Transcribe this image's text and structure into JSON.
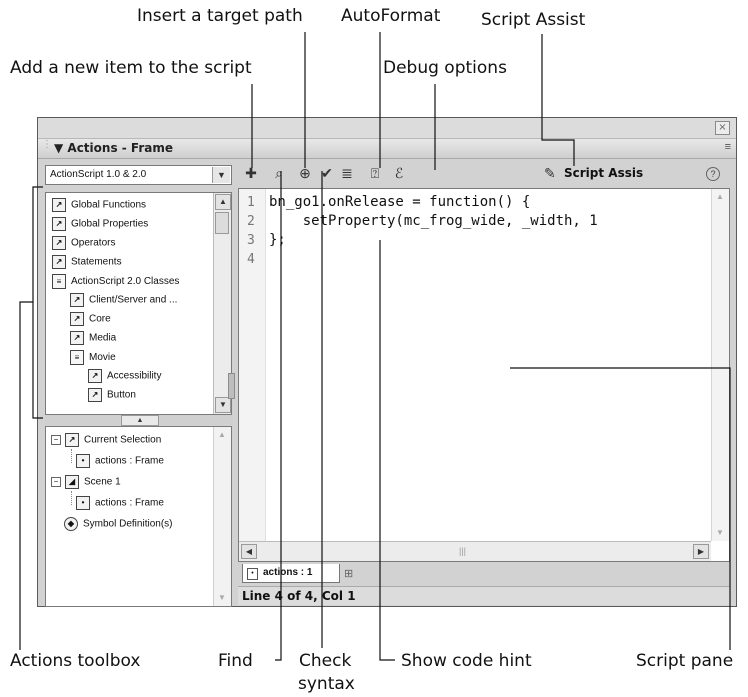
{
  "callouts": {
    "insert_target_path": "Insert a target path",
    "autoformat": "AutoFormat",
    "script_assist": "Script Assist",
    "add_item": "Add a new item to the script",
    "debug_options": "Debug options",
    "actions_toolbox": "Actions toolbox",
    "find": "Find",
    "check_syntax_1": "Check",
    "check_syntax_2": "syntax",
    "show_code_hint": "Show code hint",
    "script_pane": "Script pane"
  },
  "panel": {
    "title": "Actions - Frame",
    "close_glyph": "×",
    "menu_glyph": "≡"
  },
  "language_select": {
    "value": "ActionScript 1.0 & 2.0"
  },
  "toolbox": {
    "items": [
      {
        "label": "Global Functions",
        "kind": "book"
      },
      {
        "label": "Global Properties",
        "kind": "book"
      },
      {
        "label": "Operators",
        "kind": "book"
      },
      {
        "label": "Statements",
        "kind": "book"
      },
      {
        "label": "ActionScript 2.0 Classes",
        "kind": "open-book"
      },
      {
        "label": "Client/Server and ...",
        "kind": "book"
      },
      {
        "label": "Core",
        "kind": "book"
      },
      {
        "label": "Media",
        "kind": "book"
      },
      {
        "label": "Movie",
        "kind": "open-book"
      },
      {
        "label": "Accessibility",
        "kind": "book"
      },
      {
        "label": "Button",
        "kind": "book"
      }
    ]
  },
  "script_nav": {
    "items": [
      {
        "label": "Current Selection",
        "expander": "⊟"
      },
      {
        "label": "actions : Frame"
      },
      {
        "label": "Scene 1",
        "expander": "⊟"
      },
      {
        "label": "actions : Frame"
      },
      {
        "label": "Symbol Definition(s)"
      }
    ]
  },
  "toolbar": {
    "script_assist_label": "Script Assis",
    "help_glyph": "?"
  },
  "code": {
    "line_numbers": [
      "1",
      "2",
      "3",
      "4"
    ],
    "lines": [
      "bn_go1.onRelease = function() {",
      "    setProperty(mc_frog_wide, _width, 1",
      "};",
      ""
    ]
  },
  "tab": {
    "label": "actions : 1"
  },
  "status": {
    "text": "Line 4 of 4, Col 1"
  },
  "icons": {
    "add": "add-item-icon",
    "find": "find-icon",
    "target": "insert-target-path-icon",
    "check": "check-syntax-icon",
    "autoformat": "autoformat-icon",
    "code_hint": "show-code-hint-icon",
    "debug": "debug-options-icon",
    "script_assist": "script-assist-wand-icon",
    "help": "help-icon"
  }
}
